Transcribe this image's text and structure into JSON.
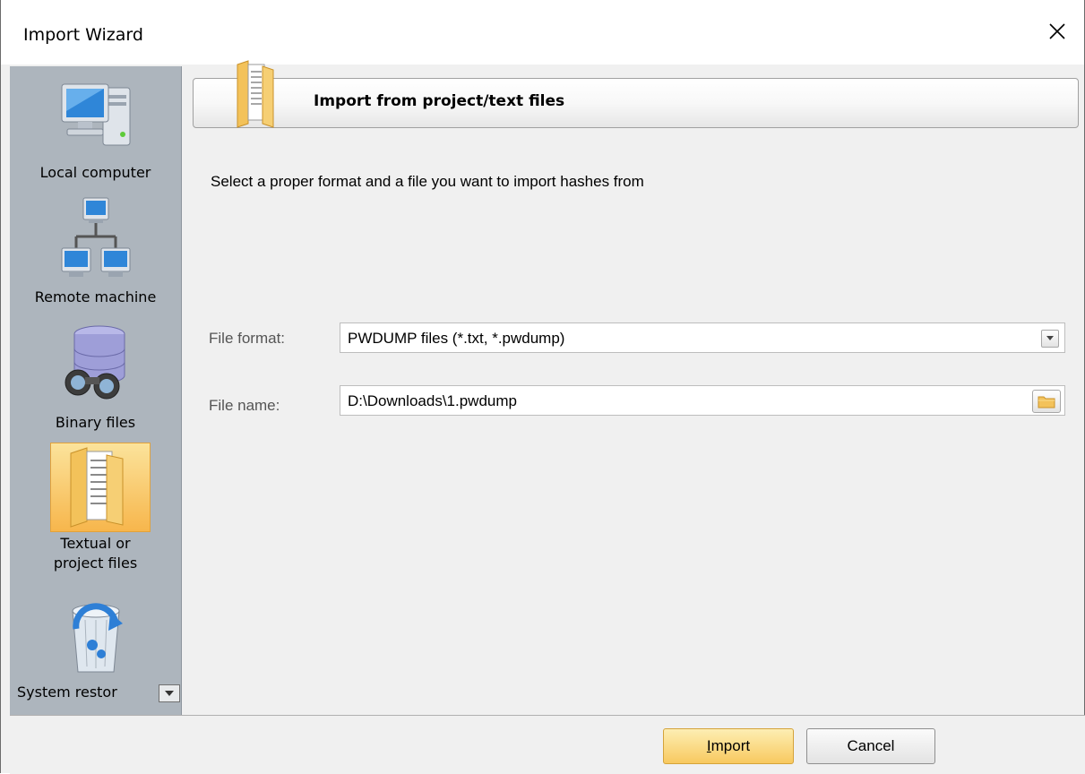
{
  "window": {
    "title": "Import Wizard"
  },
  "sidebar": {
    "items": [
      {
        "label": "Local computer",
        "icon": "computer-icon",
        "selected": false
      },
      {
        "label": "Remote machine",
        "icon": "network-icon",
        "selected": false
      },
      {
        "label": "Binary files",
        "icon": "database-binoculars-icon",
        "selected": false
      },
      {
        "label": "Textual or project files",
        "label_lines": [
          "Textual or",
          "project files"
        ],
        "icon": "folder-document-icon",
        "selected": true
      },
      {
        "label": "System restor",
        "icon": "recycle-bin-icon",
        "selected": false
      }
    ]
  },
  "header": {
    "title": "Import from project/text files",
    "icon": "folder-document-icon"
  },
  "instructions": "Select a proper format and a file you want to import hashes from",
  "form": {
    "file_format": {
      "label": "File format:",
      "value": "PWDUMP files (*.txt, *.pwdump)"
    },
    "file_name": {
      "label": "File name:",
      "value": "D:\\Downloads\\1.pwdump"
    }
  },
  "buttons": {
    "import_label_rest": "mport",
    "import_label_hotkey": "I",
    "cancel_label": "Cancel"
  },
  "colors": {
    "accent": "#f8c95f",
    "sidebar_bg": "#adb5bd"
  }
}
